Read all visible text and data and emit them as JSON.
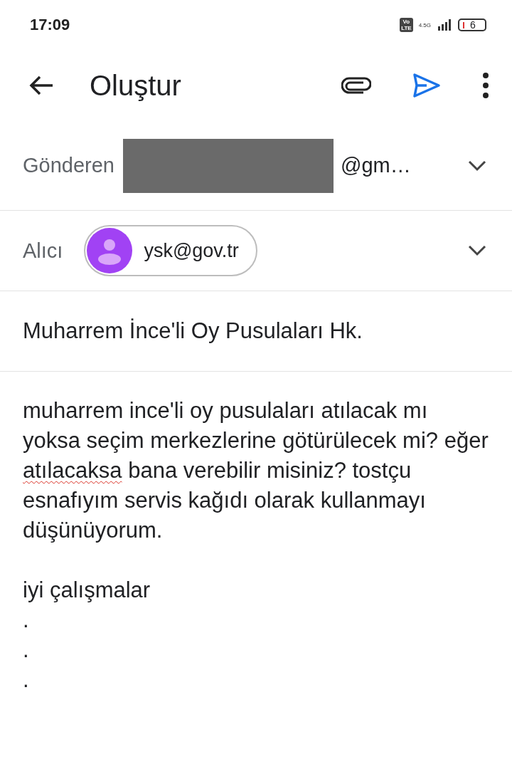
{
  "status_bar": {
    "time": "17:09",
    "volte": "Vo\nLTE",
    "network": "4.5G",
    "battery": "6"
  },
  "toolbar": {
    "title": "Oluştur"
  },
  "sender": {
    "label": "Gönderen",
    "value": "@gm…",
    "redacted": true
  },
  "recipient": {
    "label": "Alıcı",
    "chips": [
      "ysk@gov.tr"
    ]
  },
  "subject": "Muharrem İnce'li Oy Pusulaları Hk.",
  "body": {
    "paragraph": [
      {
        "text": "muharrem ince'li oy pusulaları atılacak mı yoksa seçim merkezlerine götürülecek mi? eğer ",
        "misspelled": false
      },
      {
        "text": "atılacaksa",
        "misspelled": true
      },
      {
        "text": " bana verebilir misiniz? tostçu esnafıyım servis kağıdı olarak kullanmayı düşünüyorum.",
        "misspelled": false
      }
    ],
    "sign_off": "iyi çalışmalar",
    "trailing_lines": [
      ".",
      ".",
      "."
    ]
  }
}
